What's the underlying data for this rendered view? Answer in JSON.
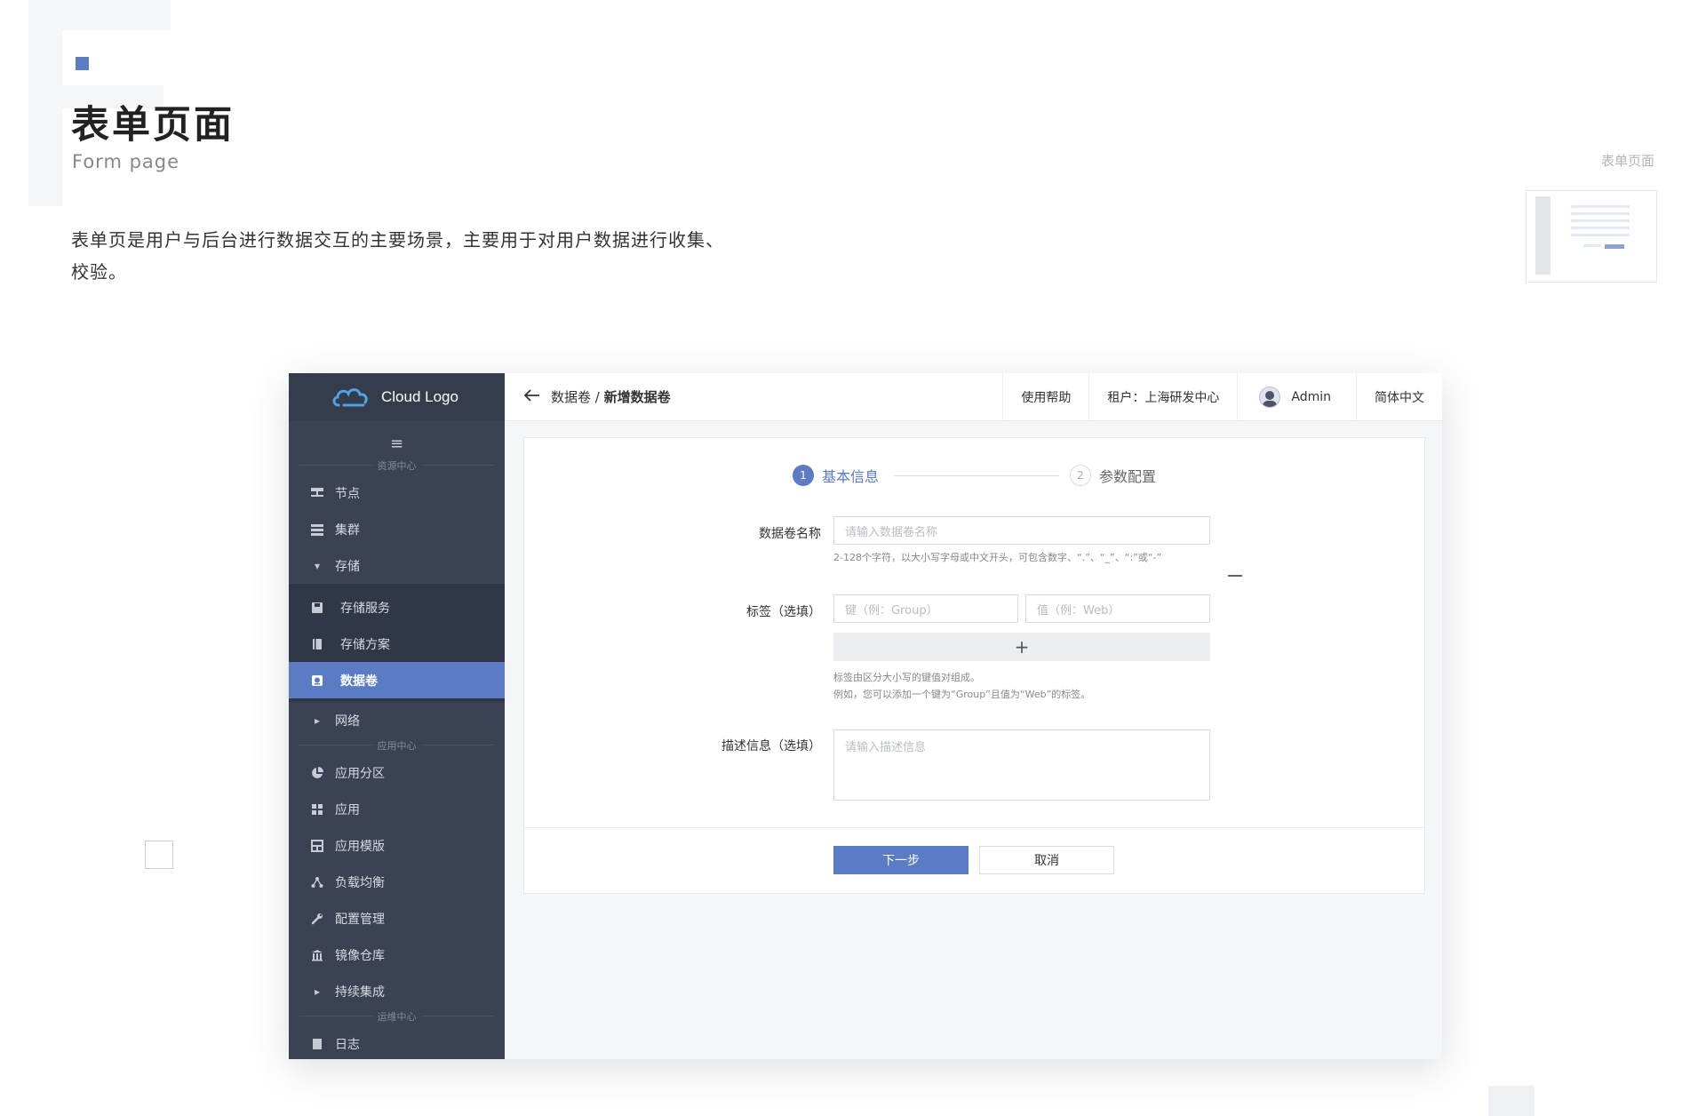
{
  "intro": {
    "title": "表单页面",
    "subtitle": "Form page",
    "description_line1": "表单页是用户与后台进行数据交互的主要场景，主要用于对用户数据进行收集、",
    "description_line2": "校验。",
    "thumbnail_label": "表单页面"
  },
  "colors": {
    "accent": "#5b7cc4",
    "sidebar": "#3a4254"
  },
  "sidebar": {
    "logo_text": "Cloud Logo",
    "menu_icon": "≡",
    "sections": {
      "resource": "资源中心",
      "app": "应用中心",
      "ops": "运维中心"
    },
    "items": {
      "node": "节点",
      "cluster": "集群",
      "storage": "存储",
      "storage_service": "存储服务",
      "storage_plan": "存储方案",
      "volume": "数据卷",
      "network": "网络",
      "app_partition": "应用分区",
      "app": "应用",
      "app_template": "应用模版",
      "load_balance": "负载均衡",
      "config_manage": "配置管理",
      "image_repo": "镜像仓库",
      "ci": "持续集成",
      "log": "日志"
    }
  },
  "topbar": {
    "crumb_parent": "数据卷",
    "crumb_sep": " / ",
    "crumb_current": "新增数据卷",
    "help": "使用帮助",
    "tenant": "租户：上海研发中心",
    "user": "Admin",
    "language": "简体中文"
  },
  "form": {
    "steps": [
      {
        "num": "1",
        "label": "基本信息"
      },
      {
        "num": "2",
        "label": "参数配置"
      }
    ],
    "name_label": "数据卷名称",
    "name_placeholder": "请输入数据卷名称",
    "name_hint": "2-128个字符，以大小写字母或中文开头，可包含数字、“.”、“_”、“:”或“-”",
    "tag_label": "标签（选填）",
    "tag_key_placeholder": "键（例：Group）",
    "tag_value_placeholder": "值（例：Web）",
    "add_symbol": "+",
    "tag_hint_1": "标签由区分大小写的键值对组成。",
    "tag_hint_2": "例如，您可以添加一个键为“Group”且值为“Web”的标签。",
    "desc_label": "描述信息（选填）",
    "desc_placeholder": "请输入描述信息",
    "next_button": "下一步",
    "cancel_button": "取消"
  }
}
